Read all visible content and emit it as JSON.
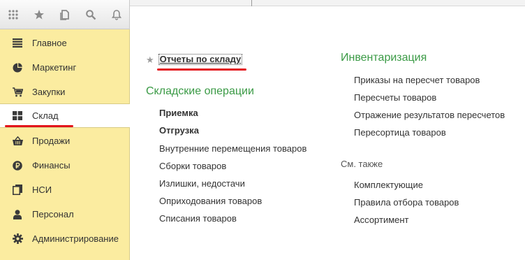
{
  "toolbar": {
    "icons": [
      "apps-grid-icon",
      "star-icon",
      "history-icon",
      "search-icon",
      "bell-icon"
    ]
  },
  "sidebar": {
    "items": [
      {
        "label": "Главное",
        "icon": "menu-lines-icon"
      },
      {
        "label": "Маркетинг",
        "icon": "pie-chart-icon"
      },
      {
        "label": "Закупки",
        "icon": "cart-icon"
      },
      {
        "label": "Склад",
        "icon": "warehouse-grid-icon",
        "active": true
      },
      {
        "label": "Продажи",
        "icon": "basket-icon"
      },
      {
        "label": "Финансы",
        "icon": "ruble-icon"
      },
      {
        "label": "НСИ",
        "icon": "documents-icon"
      },
      {
        "label": "Персонал",
        "icon": "person-icon"
      },
      {
        "label": "Администрирование",
        "icon": "gear-icon"
      }
    ]
  },
  "content": {
    "favorite_link": "Отчеты по складу",
    "left_group": {
      "title": "Складские операции",
      "links": [
        {
          "label": "Приемка",
          "bold": true
        },
        {
          "label": "Отгрузка",
          "bold": true
        },
        {
          "label": "Внутренние перемещения товаров",
          "bold": false
        },
        {
          "label": "Сборки товаров",
          "bold": false
        },
        {
          "label": "Излишки, недостачи",
          "bold": false
        },
        {
          "label": "Оприходования товаров",
          "bold": false
        },
        {
          "label": "Списания товаров",
          "bold": false
        }
      ]
    },
    "right_group": {
      "title": "Инвентаризация",
      "links": [
        "Приказы на пересчет товаров",
        "Пересчеты товаров",
        "Отражение результатов пересчетов",
        "Пересортица товаров"
      ]
    },
    "see_also": {
      "title": "См. также",
      "links": [
        "Комплектующие",
        "Правила отбора товаров",
        "Ассортимент"
      ]
    }
  },
  "colors": {
    "sidebar_bg": "#fbeca0",
    "group_title": "#3a9a45",
    "annotation_red": "#e3141b"
  }
}
